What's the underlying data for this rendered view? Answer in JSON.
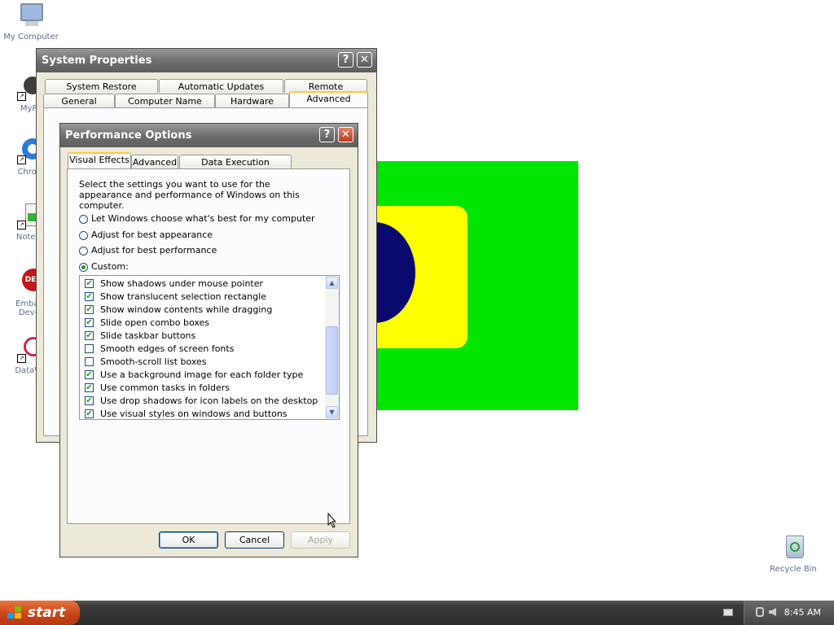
{
  "desktop": {
    "icons": [
      {
        "label": "My Computer"
      },
      {
        "label": "MyPe"
      },
      {
        "label": "Chrom"
      },
      {
        "label": "Notepa"
      },
      {
        "label": "Embarc Dev-C"
      },
      {
        "label": "DataWa"
      },
      {
        "label": "Recycle Bin"
      }
    ]
  },
  "system_properties": {
    "title": "System Properties",
    "tabs_row1": [
      "System Restore",
      "Automatic Updates",
      "Remote"
    ],
    "tabs_row2": [
      "General",
      "Computer Name",
      "Hardware",
      "Advanced"
    ],
    "active_tab": "Advanced"
  },
  "performance_options": {
    "title": "Performance Options",
    "tabs": [
      "Visual Effects",
      "Advanced",
      "Data Execution Prevention"
    ],
    "active_tab": "Visual Effects",
    "description": "Select the settings you want to use for the appearance and performance of Windows on this computer.",
    "radios": [
      {
        "label": "Let Windows choose what's best for my computer",
        "checked": false
      },
      {
        "label": "Adjust for best appearance",
        "checked": false
      },
      {
        "label": "Adjust for best performance",
        "checked": false
      },
      {
        "label": "Custom:",
        "checked": true
      }
    ],
    "effects": [
      {
        "label": "Show shadows under mouse pointer",
        "checked": true
      },
      {
        "label": "Show translucent selection rectangle",
        "checked": true
      },
      {
        "label": "Show window contents while dragging",
        "checked": true
      },
      {
        "label": "Slide open combo boxes",
        "checked": true
      },
      {
        "label": "Slide taskbar buttons",
        "checked": true
      },
      {
        "label": "Smooth edges of screen fonts",
        "checked": false
      },
      {
        "label": "Smooth-scroll list boxes",
        "checked": false
      },
      {
        "label": "Use a background image for each folder type",
        "checked": true
      },
      {
        "label": "Use common tasks in folders",
        "checked": true
      },
      {
        "label": "Use drop shadows for icon labels on the desktop",
        "checked": true
      },
      {
        "label": "Use visual styles on windows and buttons",
        "checked": true
      }
    ],
    "buttons": {
      "ok": "OK",
      "cancel": "Cancel",
      "apply": "Apply"
    }
  },
  "taskbar": {
    "start_label": "start",
    "clock": "8:45 AM"
  },
  "colors": {
    "art_green": "#00e600",
    "art_yellow": "#ffff00",
    "art_navy": "#0a0a6e"
  }
}
